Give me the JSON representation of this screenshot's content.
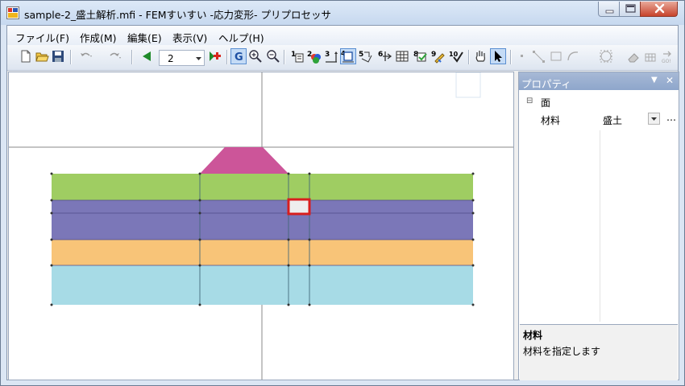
{
  "window": {
    "title": "sample-2_盛土解析.mfi - FEMすいすい -応力変形- プリプロセッサ"
  },
  "menu": {
    "items": [
      "ファイル(F)",
      "作成(M)",
      "編集(E)",
      "表示(V)",
      "ヘルプ(H)"
    ]
  },
  "toolbar": {
    "zoom_value": "2",
    "icons": [
      "new-file-icon",
      "open-folder-icon",
      "save-icon",
      "undo-icon",
      "redo-icon",
      "previous-step-icon",
      "zoom-level-select",
      "add-step-icon",
      "grid-toggle-icon",
      "zoom-in-icon",
      "zoom-out-icon",
      "node-number-icon",
      "material-color-icon",
      "dimension-icon",
      "element-frame-icon",
      "element-number-icon",
      "boundary-condition-icon",
      "table-icon",
      "material-number-icon",
      "edit-check-icon",
      "validate-check-icon",
      "pan-hand-icon",
      "select-arrow-icon",
      "point-tool-icon",
      "line-tool-icon",
      "rectangle-tool-icon",
      "arc-tool-icon",
      "polygon-tool-icon",
      "erase-tool-icon",
      "mesh-tool-icon",
      "go-run-icon"
    ]
  },
  "properties": {
    "panel_title": "プロパティ",
    "category": "面",
    "row_label": "材料",
    "row_value": "盛土",
    "description_title": "材料",
    "description_text": "材料を指定します"
  },
  "colors": {
    "embankment": "#cc5599",
    "layer_green": "#9fcd62",
    "layer_purple": "#7b77b8",
    "layer_orange": "#f8c478",
    "layer_cyan": "#a7dbe6",
    "selection": "#d81e1e"
  }
}
